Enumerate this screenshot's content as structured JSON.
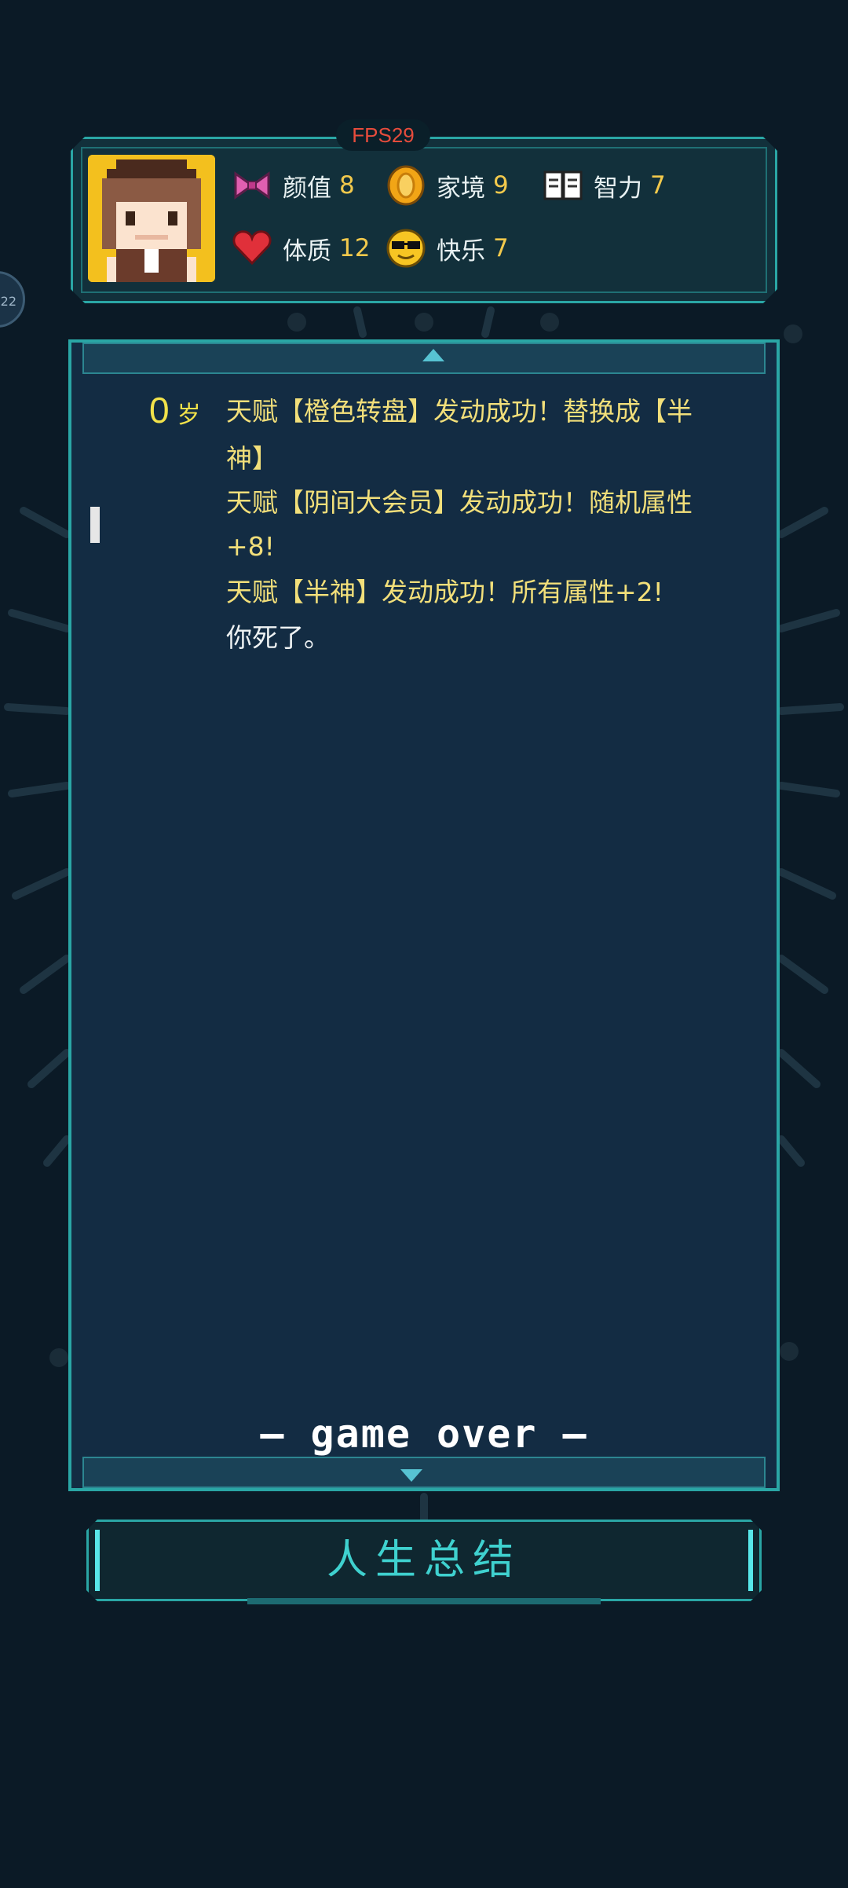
{
  "overlay": {
    "fps_label": "FPS29",
    "side_bubble_text": "22"
  },
  "attributes": [
    {
      "name": "颜值",
      "value": "8",
      "icon": "bow-icon"
    },
    {
      "name": "家境",
      "value": "9",
      "icon": "coin-icon"
    },
    {
      "name": "智力",
      "value": "7",
      "icon": "book-icon"
    },
    {
      "name": "体质",
      "value": "12",
      "icon": "heart-icon"
    },
    {
      "name": "快乐",
      "value": "7",
      "icon": "sunglasses-face-icon"
    }
  ],
  "log": {
    "age_value": "0",
    "age_unit": "岁",
    "lines": [
      "天赋【橙色转盘】发动成功！替换成【半",
      "神】",
      "天赋【阴间大会员】发动成功！随机属性",
      "+8!",
      "天赋【半神】发动成功！所有属性+2!",
      "你死了。"
    ],
    "game_over": "— game over —"
  },
  "actions": {
    "summary_button": "人生总结"
  },
  "colors": {
    "background": "#0b1a26",
    "panel": "#132c43",
    "accent": "#2aa6a5",
    "event_text": "#f2df7a",
    "value_text": "#f2c94c",
    "fps_text": "#e74c3c"
  }
}
